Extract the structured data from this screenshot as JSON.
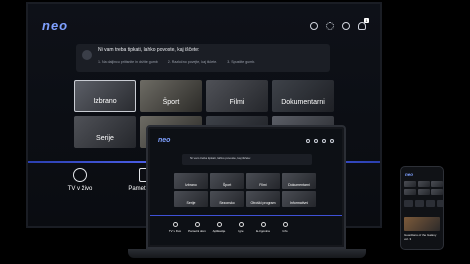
{
  "tv": {
    "logo": "neo",
    "notification_count": "1",
    "voice": {
      "title": "Ni vam treba tipkati, lahko povoste, kaj iščete:",
      "steps": [
        "1. Na daljincu pritisnite in držite gumb",
        "2. Razločno povejte, kaj iščete.",
        "3. Spustite gumb."
      ]
    },
    "tiles": [
      "Izbrano",
      "Šport",
      "Filmi",
      "Dokumentarni",
      "Serije",
      "",
      "",
      ""
    ],
    "nav": [
      "TV v živo",
      "Pametni dom"
    ]
  },
  "laptop": {
    "logo": "neo",
    "voice_title": "Ni vam treba tipkati, lahko povoste, kaj iščete:",
    "tiles": [
      "Izbrano",
      "Šport",
      "Filmi",
      "Dokumentarni",
      "Serije",
      "Sezonsko",
      "Otroški program",
      "Informativni"
    ],
    "nav": [
      "TV v živo",
      "Pametni dom",
      "Aplikacije",
      "Igre",
      "E-trgovina",
      "Info"
    ]
  },
  "phone": {
    "logo": "neo",
    "caption": "Guardians of the Galaxy vol. 3"
  },
  "colors": {
    "accent": "#5a6cff",
    "logo": "#7fa0ff",
    "background": "#0a0c11"
  }
}
